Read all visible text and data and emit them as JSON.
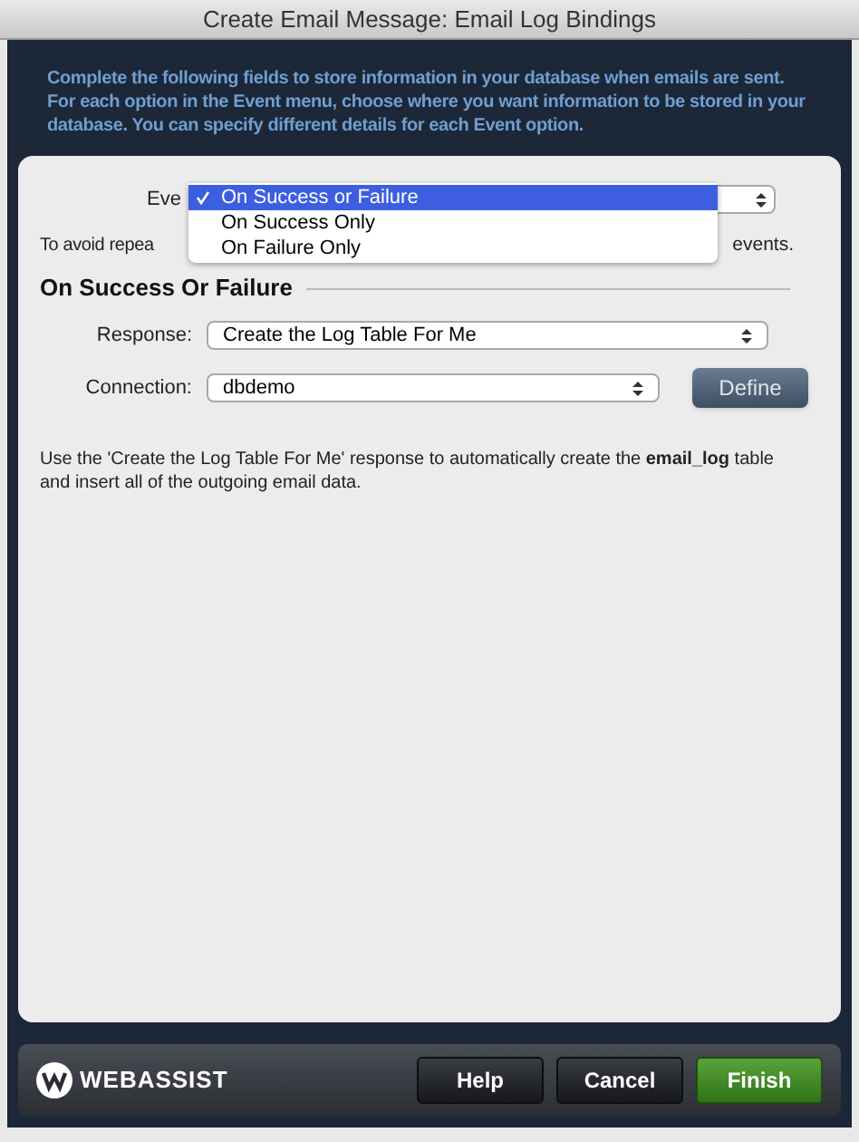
{
  "window": {
    "title": "Create Email Message: Email Log Bindings"
  },
  "intro": "Complete the following fields to store information in your database when emails are sent. For each option in the Event menu, choose where you want information to be stored in your database. You can specify different details for each Event option.",
  "event": {
    "label": "Eve",
    "menu": [
      {
        "label": "On Success or Failure",
        "selected": true
      },
      {
        "label": "On Success Only",
        "selected": false
      },
      {
        "label": "On Failure Only",
        "selected": false
      }
    ]
  },
  "hint": {
    "start": "To avoid repea",
    "end": "events."
  },
  "section": {
    "title": "On Success Or Failure",
    "fields": [
      {
        "kind": "select",
        "label": "Response:",
        "value": "Create the Log Table For Me"
      },
      {
        "kind": "select_button",
        "label": "Connection:",
        "value": "dbdemo",
        "button": "Define"
      }
    ]
  },
  "note": "Use the 'Create the Log Table For Me' response to automatically create the **email_log** table and insert all of the outgoing email data.",
  "footer": {
    "logo": "WEBASSIST",
    "buttons": [
      {
        "label": "Help",
        "kind": "dark"
      },
      {
        "label": "Cancel",
        "kind": "dark"
      },
      {
        "label": "Finish",
        "kind": "primary"
      }
    ]
  }
}
